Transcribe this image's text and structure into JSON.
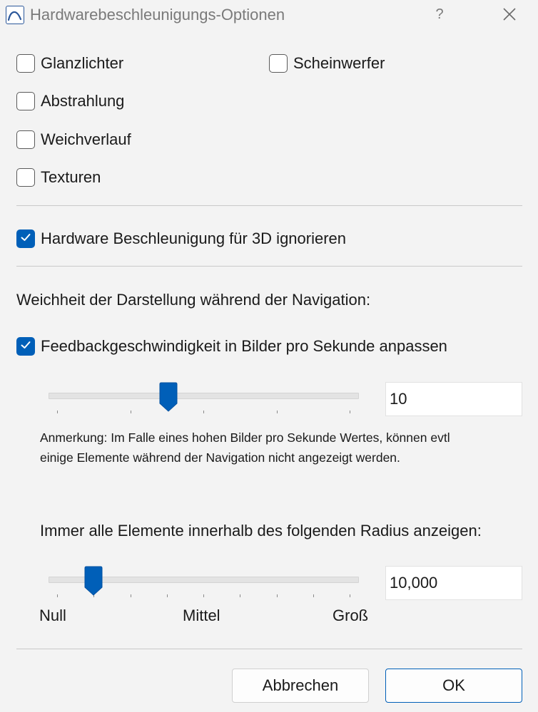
{
  "window": {
    "title": "Hardwarebeschleunigungs-Optionen",
    "help_label": "?"
  },
  "options": {
    "highlights": {
      "label": "Glanzlichter",
      "checked": false
    },
    "spotlights": {
      "label": "Scheinwerfer",
      "checked": false
    },
    "radiation": {
      "label": "Abstrahlung",
      "checked": false
    },
    "gradient": {
      "label": "Weichverlauf",
      "checked": false
    },
    "textures": {
      "label": "Texturen",
      "checked": false
    }
  },
  "ignore_hw": {
    "label": "Hardware Beschleunigung für 3D ignorieren",
    "checked": true
  },
  "navigation": {
    "heading": "Weichheit der Darstellung während der Navigation:",
    "fps_adjust": {
      "label": "Feedbackgeschwindigkeit in Bilder pro Sekunde anpassen",
      "checked": true
    },
    "fps_value": "10",
    "fps_slider_fraction": 0.38,
    "note_line1": "Anmerkung: Im Falle eines hohen Bilder pro Sekunde Wertes, können evtl",
    "note_line2": "einige Elemente während der Navigation nicht angezeigt werden."
  },
  "radius": {
    "heading": "Immer alle Elemente innerhalb des folgenden Radius anzeigen:",
    "value": "10,000",
    "slider_fraction": 0.125,
    "label_min": "Null",
    "label_mid": "Mittel",
    "label_max": "Groß"
  },
  "buttons": {
    "cancel": "Abbrechen",
    "ok": "OK"
  },
  "colors": {
    "accent": "#005fb8"
  }
}
